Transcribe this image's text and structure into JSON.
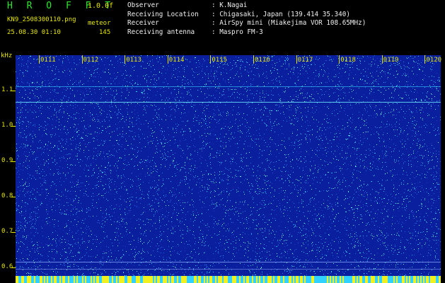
{
  "header": {
    "title": "H R O F F T",
    "version": "1.0.0f",
    "filename": "KN9_2508300110.png",
    "meteor_label": "meteor",
    "datetime": "25.08.30 01:10",
    "count": "145"
  },
  "info": {
    "observer_label": "Observer",
    "observer_value": "K.Nagai",
    "location_label": "Receiving Location",
    "location_value": "Chigasaki, Japan (139.414 35.340)",
    "receiver_label": "Receiver",
    "receiver_value": "AirSpy mini (Miakejima VOR 108.65MHz)",
    "antenna_label": "Receiving antenna",
    "antenna_value": "Maspro FM-3"
  },
  "axis": {
    "y_unit": "kHz",
    "y_ticks": [
      "1.1",
      "1.0",
      "0.9",
      "0.8",
      "0.7",
      "0.6"
    ],
    "x_ticks": [
      "0111",
      "0112",
      "0113",
      "0114",
      "0115",
      "0116",
      "0117",
      "0118",
      "0119",
      "0120"
    ]
  },
  "colors": {
    "background": "#0a1f9e",
    "speckle": "#30d0ff",
    "label": "#e6e600",
    "title": "#2ee62e",
    "bottom_band": "#f0f020"
  }
}
